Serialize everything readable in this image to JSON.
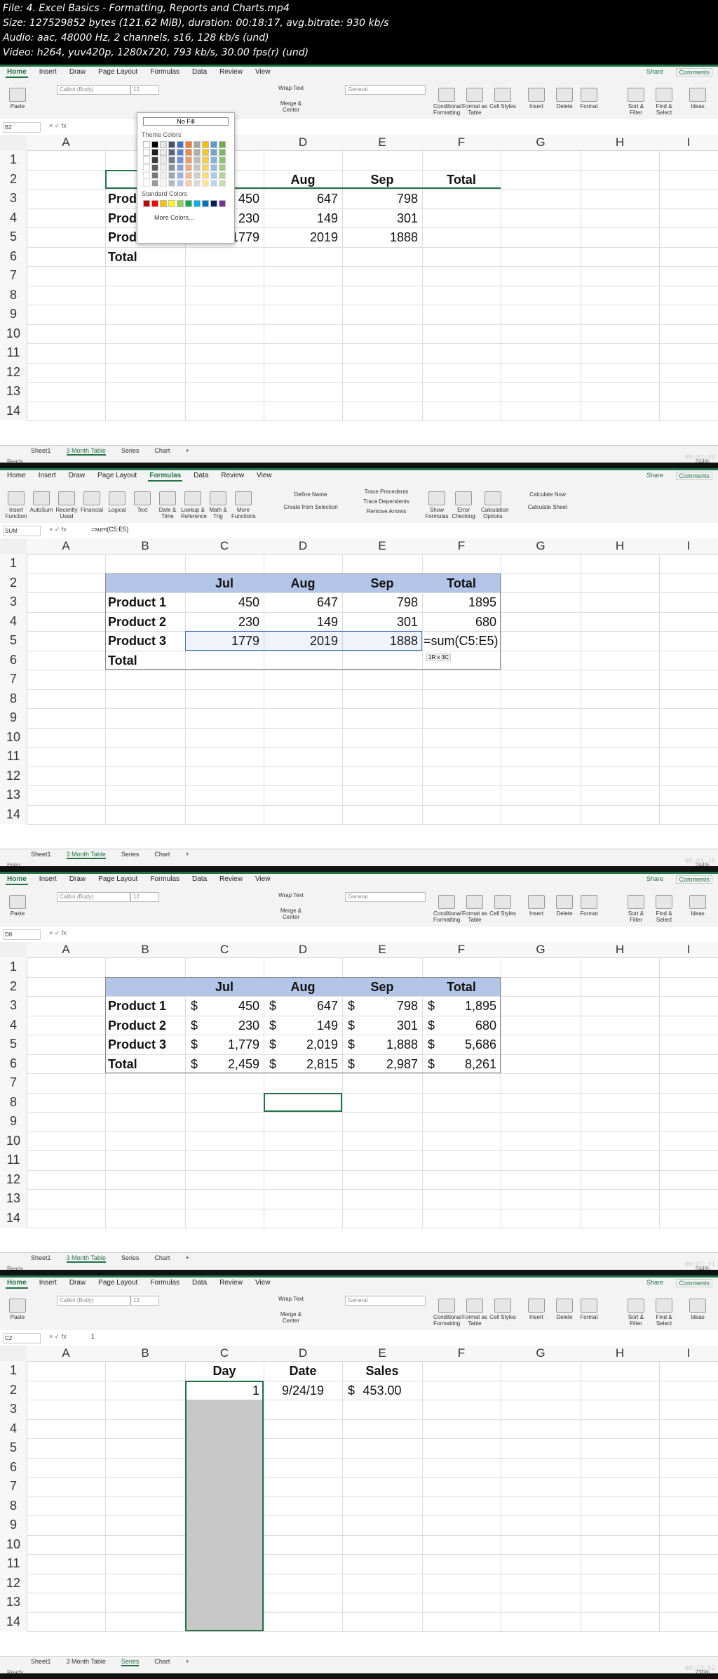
{
  "meta": {
    "line1": "File: 4. Excel Basics - Formatting, Reports and Charts.mp4",
    "line2": "Size: 127529852 bytes (121.62 MiB), duration: 00:18:17, avg.bitrate: 930 kb/s",
    "line3": "Audio: aac, 48000 Hz, 2 channels, s16, 128 kb/s (und)",
    "line4": "Video: h264, yuv420p, 1280x720, 793 kb/s, 30.00 fps(r) (und)"
  },
  "ribbon_tabs": [
    "Home",
    "Insert",
    "Draw",
    "Page Layout",
    "Formulas",
    "Data",
    "Review",
    "View"
  ],
  "share": "Share",
  "comments": "Comments",
  "font": "Calibri (Body)",
  "size": "12",
  "number_format": "General",
  "sheets": [
    "Sheet1",
    "3 Month Table",
    "Series",
    "Chart"
  ],
  "columns": [
    "A",
    "B",
    "C",
    "D",
    "E",
    "F",
    "G",
    "H",
    "I"
  ],
  "frame1": {
    "namebox": "B2",
    "formula": "",
    "status": "Ready",
    "count": "Count: 4",
    "zoom": "244%",
    "timecode": "00:01:49",
    "palette": {
      "no_fill": "No Fill",
      "theme": "Theme Colors",
      "standard": "Standard Colors",
      "more": "More Colors..."
    },
    "rows": [
      [
        "",
        "",
        "Aug",
        "Sep",
        "Total"
      ],
      [
        "Prod",
        "450",
        "647",
        "798",
        ""
      ],
      [
        "Prod",
        "230",
        "149",
        "301",
        ""
      ],
      [
        "Product 3",
        "1779",
        "2019",
        "1888",
        ""
      ],
      [
        "Total",
        "",
        "",
        "",
        ""
      ]
    ]
  },
  "frame2": {
    "namebox": "SUM",
    "formula": "=sum(C5:E5)",
    "status": "Enter",
    "zoom": "244%",
    "timecode": "00:04:10",
    "hint": "1R x 3C",
    "headers": [
      "Jul",
      "Aug",
      "Sep",
      "Total"
    ],
    "products": [
      "Product 1",
      "Product 2",
      "Product 3",
      "Total"
    ],
    "values": [
      [
        "450",
        "647",
        "798",
        "1895"
      ],
      [
        "230",
        "149",
        "301",
        "680"
      ],
      [
        "1779",
        "2019",
        "1888",
        "=sum(C5:E5)"
      ],
      [
        "",
        "",
        "",
        ""
      ]
    ]
  },
  "frame3": {
    "namebox": "D8",
    "formula": "",
    "status": "Ready",
    "zoom": "244%",
    "timecode": "00:07:31",
    "headers": [
      "Jul",
      "Aug",
      "Sep",
      "Total"
    ],
    "products": [
      "Product 1",
      "Product 2",
      "Product 3",
      "Total"
    ],
    "currency": "$",
    "values": [
      [
        "450",
        "647",
        "798",
        "1,895"
      ],
      [
        "230",
        "149",
        "301",
        "680"
      ],
      [
        "1,779",
        "2,019",
        "1,888",
        "5,686"
      ],
      [
        "2,459",
        "2,815",
        "2,987",
        "8,261"
      ]
    ]
  },
  "frame4": {
    "namebox": "C2",
    "formula": "1",
    "status": "Ready",
    "zoom": "230%",
    "timecode": "00:13:52",
    "headers": [
      "Day",
      "Date",
      "Sales"
    ],
    "row2": [
      "1",
      "9/24/19",
      "$",
      "453.00"
    ]
  },
  "ribbon_labels": {
    "home": [
      "Paste",
      "Wrap Text",
      "Merge & Center",
      "Conditional Formatting",
      "Format as Table",
      "Cell Styles",
      "Insert",
      "Delete",
      "Format",
      "Sort & Filter",
      "Find & Select",
      "Ideas"
    ],
    "formulas": [
      "Insert Function",
      "AutoSum",
      "Recently Used",
      "Financial",
      "Logical",
      "Text",
      "Date & Time",
      "Lookup & Reference",
      "Math & Trig",
      "More Functions",
      "Define Name",
      "Create from Selection",
      "Trace Precedents",
      "Trace Dependents",
      "Remove Arrows",
      "Show Formulas",
      "Error Checking",
      "Calculation Options",
      "Calculate Now",
      "Calculate Sheet"
    ]
  },
  "colors": {
    "accent": "#217346",
    "header_fill": "#b4c6e7"
  }
}
